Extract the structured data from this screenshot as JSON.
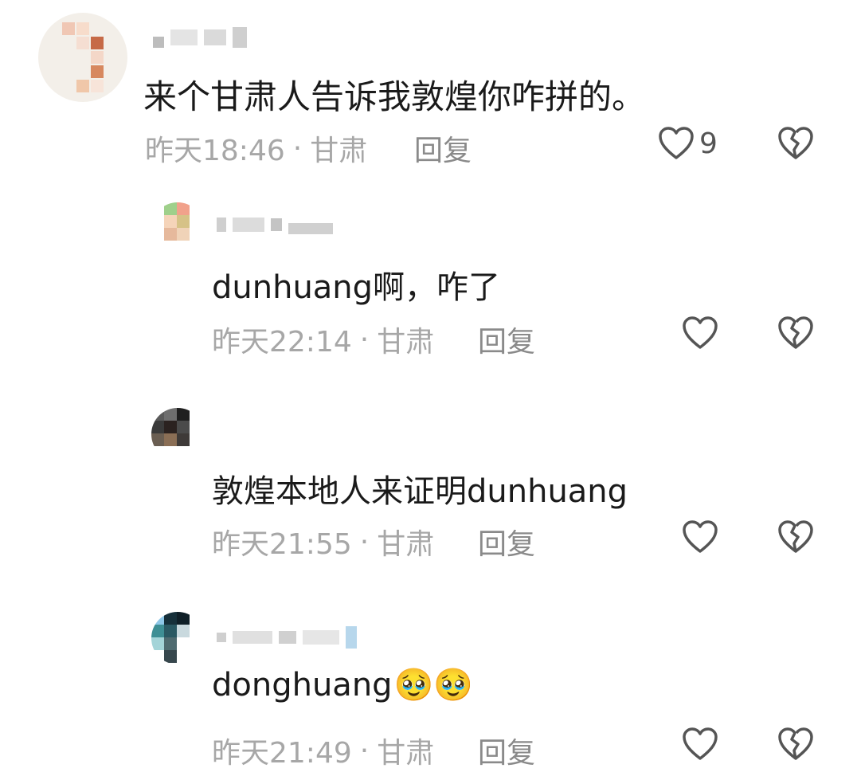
{
  "comments": [
    {
      "text": "来个甘肃人告诉我敦煌你咋拼的。",
      "time": "昨天18:46",
      "location": "甘肃",
      "sep": "·",
      "reply_label": "回复",
      "like_count": "9"
    },
    {
      "text": "dunhuang啊，咋了",
      "time": "昨天22:14",
      "location": "甘肃",
      "sep": "·",
      "reply_label": "回复",
      "like_count": ""
    },
    {
      "text": "敦煌本地人来证明dunhuang",
      "time": "昨天21:55",
      "location": "甘肃",
      "sep": "·",
      "reply_label": "回复",
      "like_count": ""
    },
    {
      "text": "donghuang",
      "emoji": "🥹🥹",
      "time": "昨天21:49",
      "location": "甘肃",
      "sep": "·",
      "reply_label": "回复",
      "like_count": ""
    }
  ],
  "icons": {
    "like": "heart-outline-icon",
    "dislike": "broken-heart-icon"
  },
  "colors": {
    "text": "#1a1a1a",
    "meta": "#a7a7a7",
    "icon": "#555555"
  }
}
